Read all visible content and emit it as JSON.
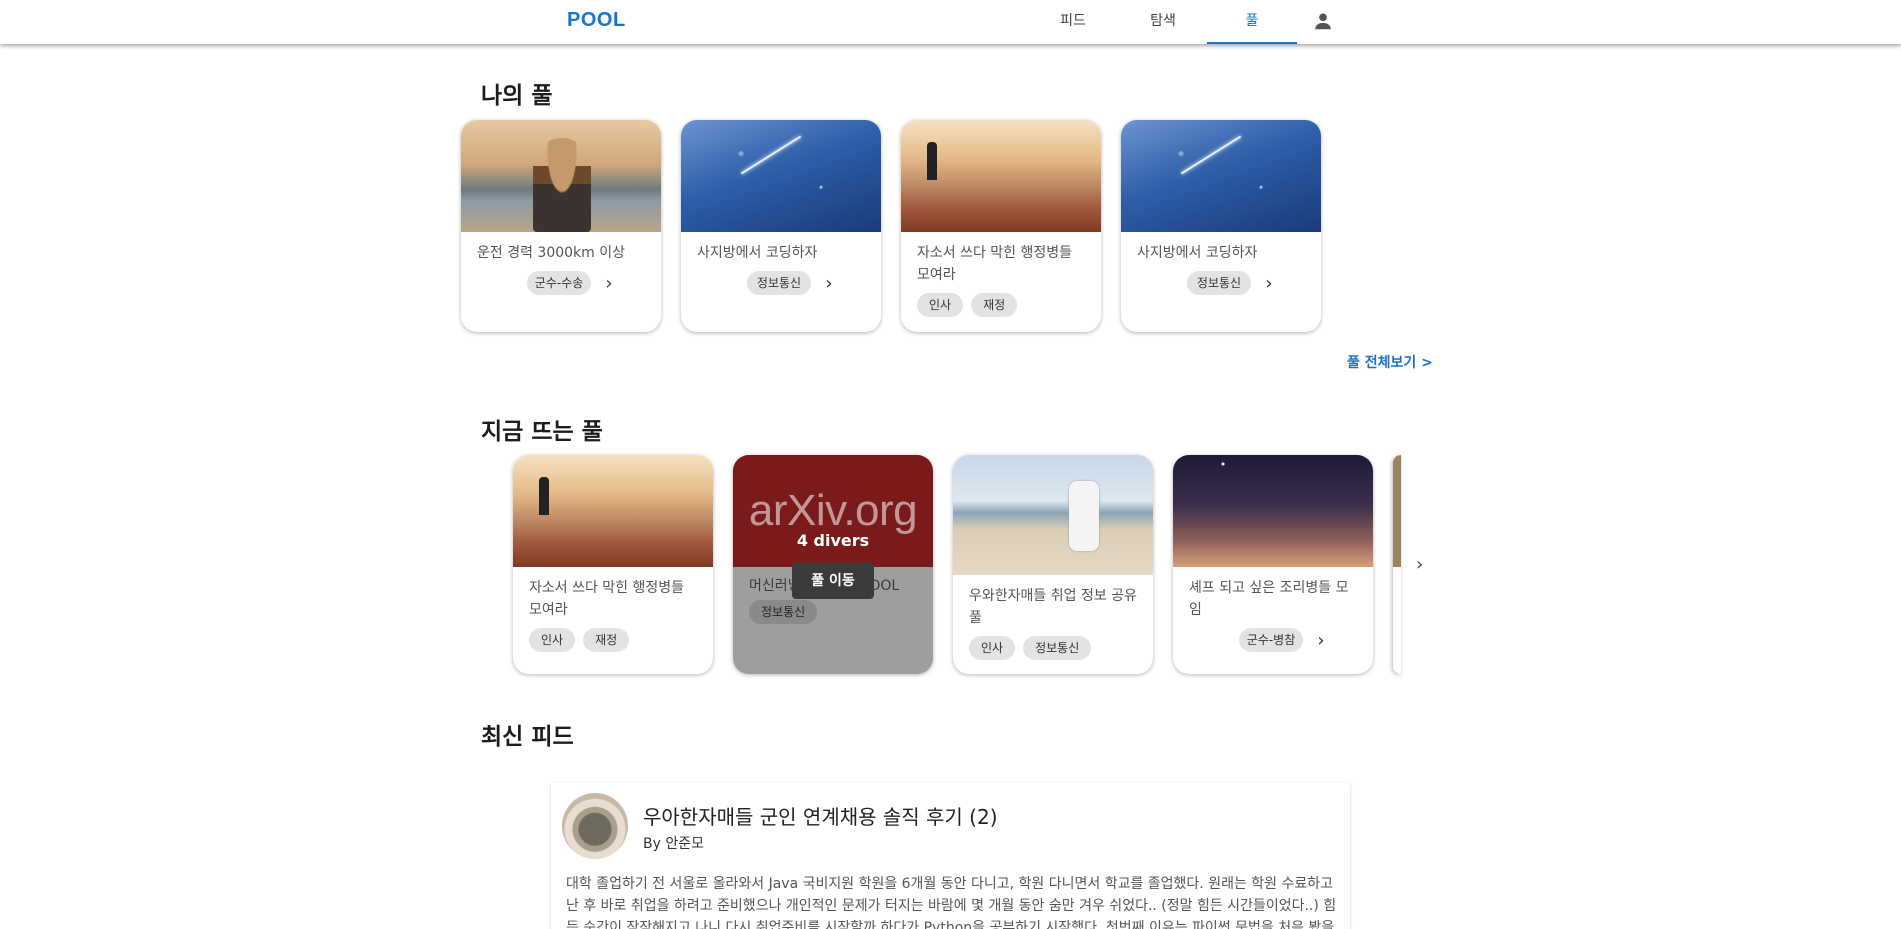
{
  "nav": {
    "logo": "POOL",
    "tabs": [
      {
        "label": "피드"
      },
      {
        "label": "탐색"
      },
      {
        "label": "풀",
        "active": true
      }
    ],
    "profile_icon": "person-icon",
    "accent_color": "#1a73c9"
  },
  "my_pools": {
    "title": "나의 풀",
    "see_all": "풀 전체보기 >",
    "cards": [
      {
        "title": "운전 경력 3000km 이상",
        "tags": [
          "군수-수송"
        ],
        "image": "man-by-sea",
        "has_chevron": true
      },
      {
        "title": "사지방에서 코딩하자",
        "tags": [
          "정보통신"
        ],
        "image": "starry-sky",
        "has_chevron": true
      },
      {
        "title": "자소서 쓰다 막힌 행정병들 모여라",
        "tags": [
          "인사",
          "재정"
        ],
        "image": "cliff-sunset",
        "has_chevron": false
      },
      {
        "title": "사지방에서 코딩하자",
        "tags": [
          "정보통신"
        ],
        "image": "starry-sky",
        "has_chevron": true
      }
    ]
  },
  "trending": {
    "title": "지금 뜨는 풀",
    "cards": [
      {
        "title": "자소서 쓰다 막힌 행정병들 모여라",
        "tags": [
          "인사",
          "재정"
        ],
        "image": "cliff-sunset"
      },
      {
        "title": "머신러닝 공부하는 POOL",
        "tags": [
          "정보통신"
        ],
        "image": "arxiv",
        "image_text": "arXiv.org",
        "overlay_count": "4 divers",
        "overlay_button": "풀 이동"
      },
      {
        "title": "우와한자매들 취업 정보 공유 풀",
        "tags": [
          "인사",
          "정보통신"
        ],
        "image": "beach-taichi"
      },
      {
        "title": "셰프 되고 싶은 조리병들 모임",
        "tags": [
          "군수-병참"
        ],
        "image": "dusk-sky",
        "has_chevron": true
      }
    ],
    "next_icon": "chevron-right-icon"
  },
  "feed": {
    "title": "최신 피드",
    "posts": [
      {
        "title": "우아한자매들 군인 연계채용 솔직 후기 (2)",
        "author": "By 안준모",
        "body": "대학 졸업하기 전 서울로 올라와서 Java 국비지원 학원을 6개월 동안 다니고, 학원 다니면서 학교를 졸업했다. 원래는 학원 수료하고 난 후 바로 취업을 하려고 준비했으나 개인적인 문제가 터지는 바람에 몇 개월 동안 숨만 겨우 쉬었다.. (정말 힘든 시간들이었다..) 힘든 순간이 잠잠해지고 나니 다시 취업준비를 시작할까 하다가 Python을 공부하기 시작했다. 첫번째 이유는 파이썬 문법을 처음 봤을 때 간단"
      }
    ]
  }
}
